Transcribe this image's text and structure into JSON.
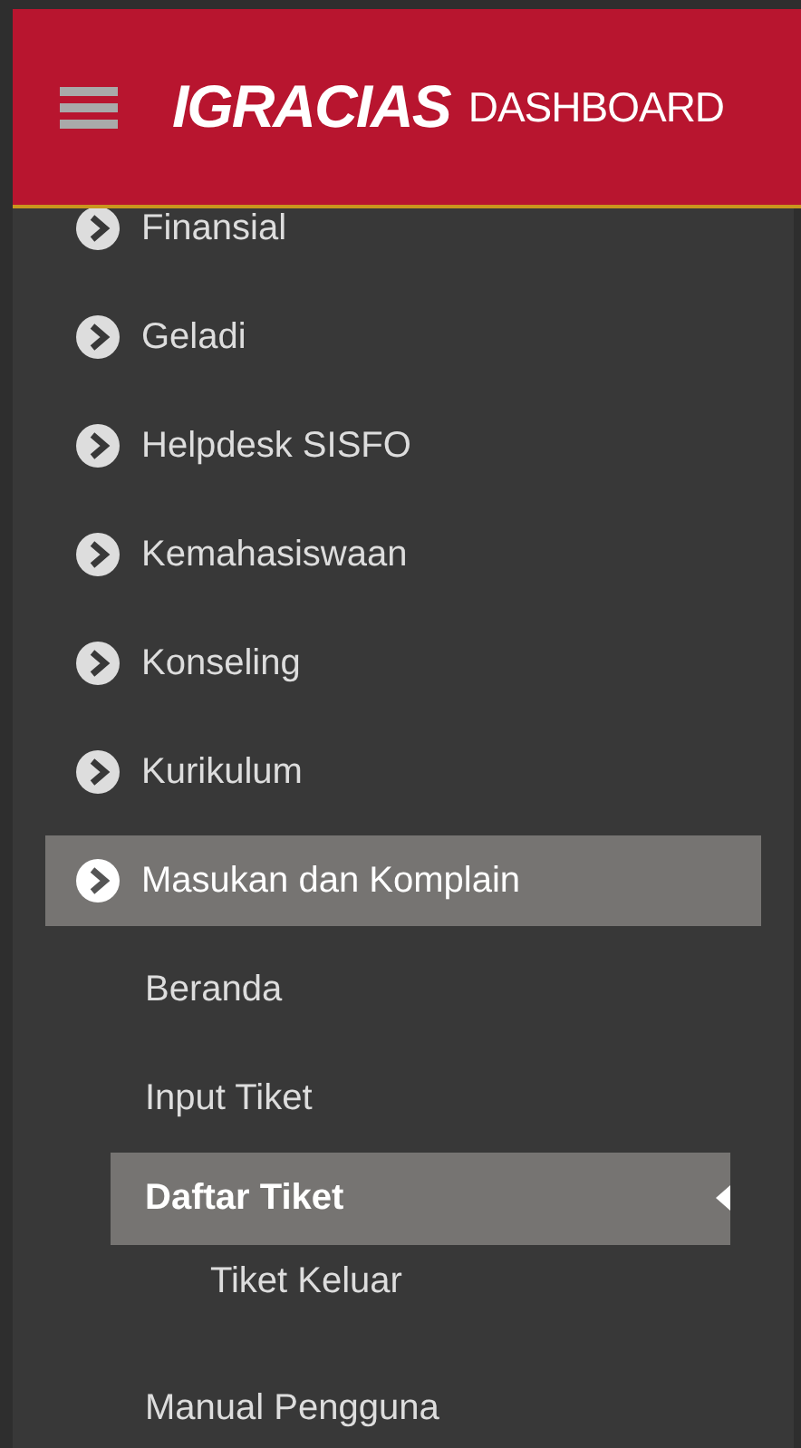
{
  "header": {
    "logo": "IGRACIAS",
    "title": "DASHBOARD"
  },
  "menu": [
    {
      "label": "Finansial",
      "selected": false
    },
    {
      "label": "Geladi",
      "selected": false
    },
    {
      "label": "Helpdesk SISFO",
      "selected": false
    },
    {
      "label": "Kemahasiswaan",
      "selected": false
    },
    {
      "label": "Konseling",
      "selected": false
    },
    {
      "label": "Kurikulum",
      "selected": false
    },
    {
      "label": "Masukan dan Komplain",
      "selected": true,
      "children": [
        {
          "label": "Beranda",
          "selected": false
        },
        {
          "label": "Input Tiket",
          "selected": false
        },
        {
          "label": "Daftar Tiket",
          "selected": true,
          "children": [
            {
              "label": "Tiket Keluar",
              "selected": false
            }
          ]
        },
        {
          "label": "Manual Pengguna",
          "selected": false
        }
      ]
    }
  ]
}
